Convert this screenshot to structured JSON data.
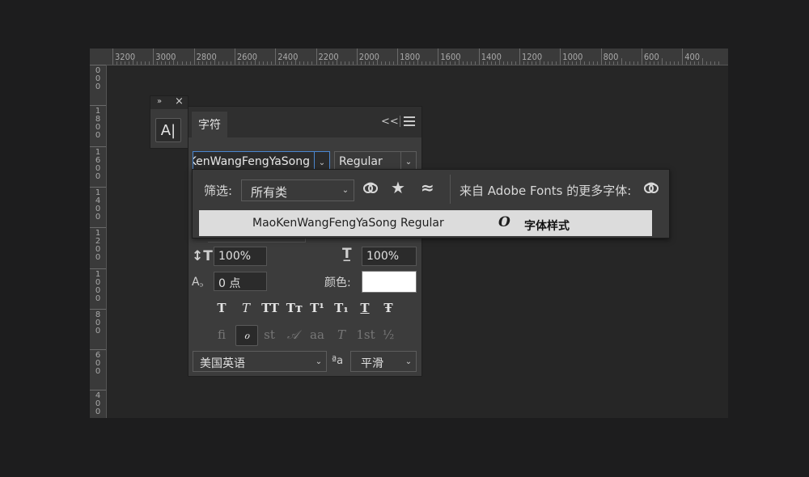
{
  "ruler": {
    "top_labels": [
      "3200",
      "3000",
      "2800",
      "2600",
      "2400",
      "2200",
      "2000",
      "1800",
      "1600",
      "1400",
      "1200",
      "1000",
      "800",
      "600",
      "400"
    ],
    "left_labels": [
      "0\n0\n0",
      "1\n8\n0\n0",
      "1\n6\n0\n0",
      "1\n4\n0\n0",
      "1\n2\n0\n0",
      "1\n0\n0\n0",
      "8\n0\n0",
      "6\n0\n0",
      "4\n0\n0"
    ]
  },
  "mini_panel": {
    "expand_icon": "»",
    "close_icon": "×",
    "char_button_label": "A|"
  },
  "char_panel": {
    "tab_label": "字符",
    "collapse_icon": "<<",
    "font_family_value": "MaoKenWangFengYaSong",
    "font_style_value": "Regular",
    "vertical_scale_value": "100%",
    "horizontal_scale_value": "100%",
    "baseline_shift_value": "0 点",
    "color_label": "颜色:",
    "color_swatch": "#ffffff",
    "style_glyphs": [
      "T",
      "T",
      "TT",
      "Tт",
      "T¹",
      "T₁",
      "T",
      "Ŧ"
    ],
    "opentype_glyphs": [
      "ﬁ",
      "ℴ",
      "st",
      "𝒜",
      "aa",
      "T",
      "1st",
      "½"
    ],
    "language_value": "美国英语",
    "aa_label": "ªa",
    "antialias_value": "平滑"
  },
  "font_popup": {
    "filter_label": "筛选:",
    "filter_value": "所有类",
    "more_fonts_label": "来自 Adobe Fonts 的更多字体:",
    "font_row": {
      "name": "MaoKenWangFengYaSong Regular",
      "type_icon": "O",
      "sample": "字体样式"
    }
  },
  "colors": {
    "accent": "#4b87d0",
    "panel_bg": "#3c3c3c",
    "canvas_bg": "#262626"
  }
}
